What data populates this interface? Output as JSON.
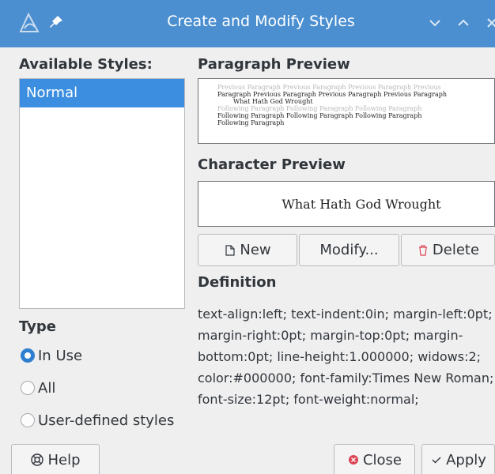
{
  "window": {
    "title": "Create and Modify Styles",
    "title_bar_color": "#4b8fd0"
  },
  "styles_panel": {
    "heading": "Available Styles:",
    "items": [
      {
        "label": "Normal",
        "selected": true
      }
    ]
  },
  "type_group": {
    "heading": "Type",
    "options": [
      {
        "label": "In Use",
        "checked": true
      },
      {
        "label": "All",
        "checked": false
      },
      {
        "label": "User-defined styles",
        "checked": false
      }
    ]
  },
  "paragraph_preview": {
    "heading": "Paragraph Preview",
    "previous_line": "Previous Paragraph Previous Paragraph Previous Paragraph Previous",
    "current_line1": "Paragraph Previous Paragraph Previous Paragraph Previous Paragraph",
    "current_line2": "What Hath God Wrought",
    "following_grey": "Following Paragraph Following Paragraph Following Paragraph",
    "following_line1": "Following Paragraph Following Paragraph Following Paragraph",
    "following_line2": "Following Paragraph"
  },
  "character_preview": {
    "heading": "Character Preview",
    "sample": "What Hath God Wrought"
  },
  "actions": {
    "new_label": "New",
    "modify_label": "Modify...",
    "delete_label": "Delete"
  },
  "definition": {
    "heading": "Definition",
    "text": "text-align:left; text-indent:0in; margin-left:0pt; margin-right:0pt; margin-top:0pt; margin-bottom:0pt; line-height:1.000000; widows:2; color:#000000; font-family:Times New Roman; font-size:12pt; font-weight:normal;"
  },
  "footer": {
    "help_label": "Help",
    "close_label": "Close",
    "apply_label": "Apply"
  },
  "colors": {
    "selection": "#3b8ee0",
    "radio_checked": "#2f7fd0",
    "delete_icon": "#da4453",
    "close_icon": "#da4453"
  }
}
